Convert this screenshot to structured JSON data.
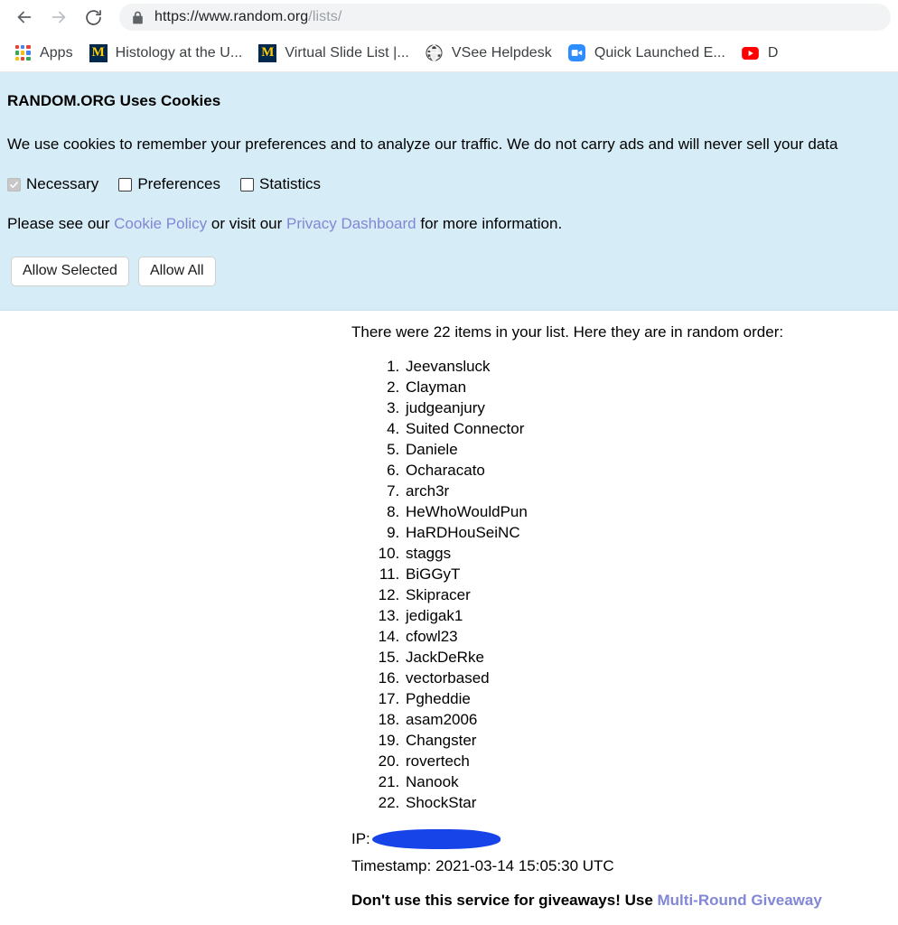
{
  "browser": {
    "back_icon": "arrow-left-icon",
    "forward_icon": "arrow-right-icon",
    "reload_icon": "reload-icon",
    "lock_icon": "lock-icon",
    "url_domain": "https://www.random.org",
    "url_path": "/lists/",
    "bookmarks": [
      {
        "label": "Apps",
        "icon": "apps-grid-icon"
      },
      {
        "label": "Histology at the U...",
        "icon": "michigan-m-icon"
      },
      {
        "label": "Virtual Slide List |...",
        "icon": "michigan-m-icon"
      },
      {
        "label": "VSee Helpdesk",
        "icon": "globe-icon"
      },
      {
        "label": "Quick Launched E...",
        "icon": "zoom-video-icon"
      },
      {
        "label": "D",
        "icon": "youtube-icon"
      }
    ]
  },
  "cookie_banner": {
    "title": "RANDOM.ORG Uses Cookies",
    "body": "We use cookies to remember your preferences and to analyze our traffic. We do not carry ads and will never sell your data",
    "choices": [
      {
        "label": "Necessary",
        "checked": true,
        "disabled": true
      },
      {
        "label": "Preferences",
        "checked": false,
        "disabled": false
      },
      {
        "label": "Statistics",
        "checked": false,
        "disabled": false
      }
    ],
    "links_prefix": "Please see our ",
    "link_cookie_policy": "Cookie Policy",
    "links_middle": " or visit our ",
    "link_privacy_dashboard": "Privacy Dashboard",
    "links_suffix": " for more information.",
    "allow_selected_label": "Allow Selected",
    "allow_all_label": "Allow All",
    "background_color": "#d6ecf6",
    "link_color": "#8287d6"
  },
  "results": {
    "intro": "There were 22 items in your list. Here they are in random order:",
    "items": [
      "Jeevansluck",
      "Clayman",
      "judgeanjury",
      "Suited Connector",
      "Daniele",
      "Ocharacato",
      "arch3r",
      "HeWhoWouldPun",
      "HaRDHouSeiNC",
      "staggs",
      "BiGGyT",
      "Skipracer",
      "jedigak1",
      "cfowl23",
      "JackDeRke",
      "vectorbased",
      "Pgheddie",
      "asam2006",
      "Changster",
      "rovertech",
      "Nanook",
      "ShockStar"
    ],
    "item_count": 22,
    "ip_label": "IP:",
    "ip_value_redacted": true,
    "redaction_color": "#1744e8",
    "timestamp_label": "Timestamp:",
    "timestamp_value": "2021-03-14 15:05:30 UTC",
    "footer_text": "Don't use this service for giveaways! Use ",
    "footer_link": "Multi-Round Giveaway"
  }
}
